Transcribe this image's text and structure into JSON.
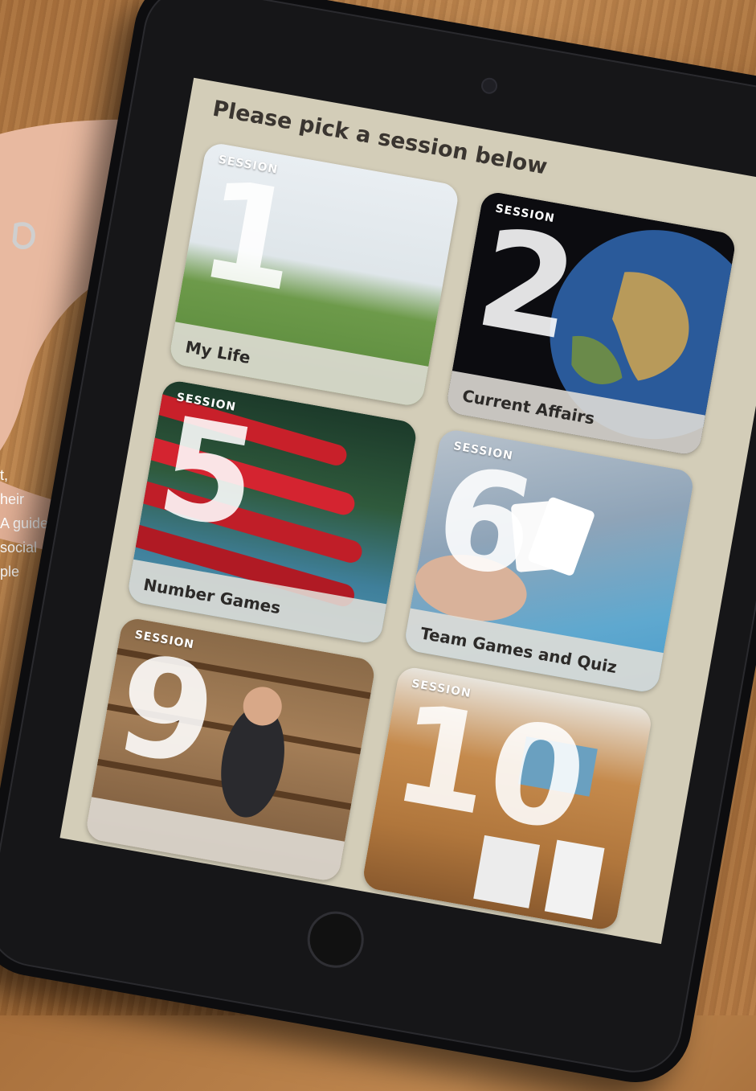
{
  "screen": {
    "heading": "Please pick a session below"
  },
  "sessions": [
    {
      "session_label": "SESSION",
      "number": "1",
      "title": "My Life"
    },
    {
      "session_label": "SESSION",
      "number": "2",
      "title": "Current Affairs"
    },
    {
      "session_label": "SESSION",
      "number": "5",
      "title": "Number Games"
    },
    {
      "session_label": "SESSION",
      "number": "6",
      "title": "Team Games and Quiz"
    },
    {
      "session_label": "SESSION",
      "number": "9",
      "title": ""
    },
    {
      "session_label": "SESSION",
      "number": "10",
      "title": ""
    }
  ],
  "side_text": {
    "lines": [
      "t,",
      "heir",
      "A guided",
      "social",
      "ple"
    ]
  },
  "colors": {
    "screen_background": "#d3cdb8",
    "tablet_bezel": "#0d0d0f",
    "label_bar": "#e1ded7",
    "heading_text": "#3a3530"
  }
}
